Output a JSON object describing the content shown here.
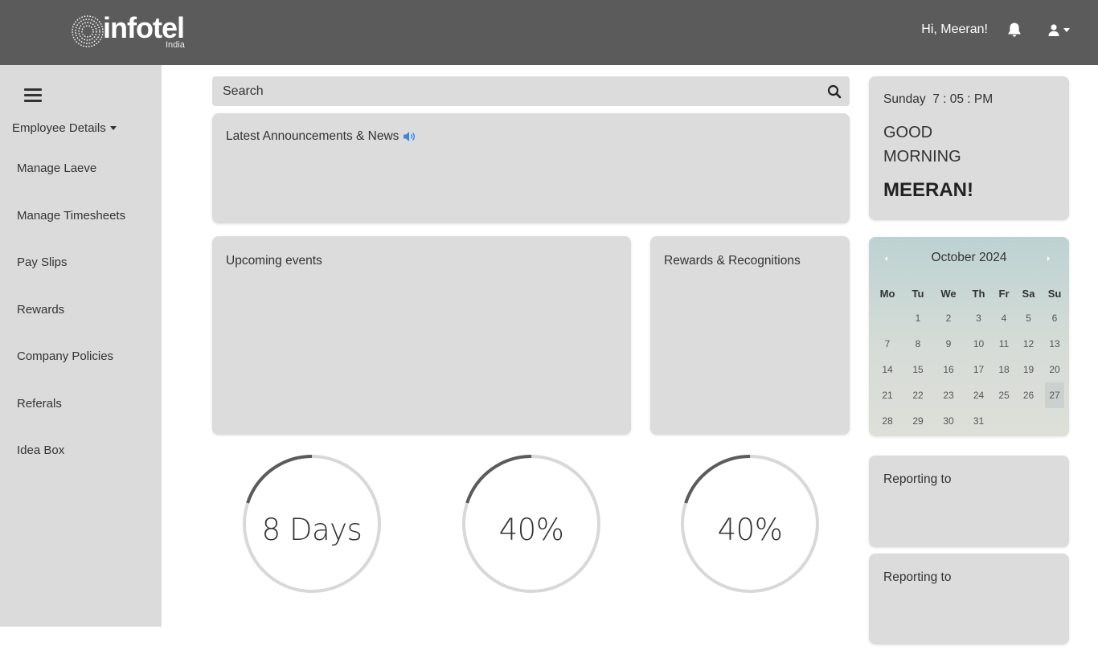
{
  "header": {
    "logo_text": "infotel",
    "logo_sub": "India",
    "greeting": "Hi, Meeran!",
    "colors": {
      "background": "#5b5b5b",
      "text": "#ffffff"
    },
    "icons": {
      "notifications": "bell-icon",
      "user": "user-icon",
      "dropdown": "caret-down-icon"
    }
  },
  "sidebar": {
    "section_label": "Employee Details",
    "items": [
      {
        "label": "Manage Laeve"
      },
      {
        "label": "Manage Timesheets"
      },
      {
        "label": "Pay Slips"
      },
      {
        "label": "Rewards"
      },
      {
        "label": "Company Policies"
      },
      {
        "label": "Referals"
      },
      {
        "label": "Idea Box"
      }
    ],
    "colors": {
      "background": "#dbdbdb"
    }
  },
  "search": {
    "placeholder": "Search",
    "icon": "search-icon"
  },
  "announcements": {
    "title": "Latest Announcements & News",
    "icon": "speaker-icon",
    "icon_color": "#3b86e0"
  },
  "events": {
    "title": "Upcoming events"
  },
  "rewards": {
    "title": "Rewards & Recognitions"
  },
  "welcome": {
    "day": "Sunday",
    "time": "7 : 05 : PM",
    "greeting": "GOOD MORNING",
    "name": "MEERAN!"
  },
  "calendar": {
    "title": "October 2024",
    "weekdays": [
      "Mo",
      "Tu",
      "We",
      "Th",
      "Fr",
      "Sa",
      "Su"
    ],
    "weeks": [
      [
        "",
        "1",
        "2",
        "3",
        "4",
        "5",
        "6"
      ],
      [
        "7",
        "8",
        "9",
        "10",
        "11",
        "12",
        "13"
      ],
      [
        "14",
        "15",
        "16",
        "17",
        "18",
        "19",
        "20"
      ],
      [
        "21",
        "22",
        "23",
        "24",
        "25",
        "26",
        "27"
      ],
      [
        "28",
        "29",
        "30",
        "31",
        "",
        "",
        ""
      ]
    ],
    "today": "27"
  },
  "stats": [
    {
      "label": "8 Days",
      "progress": 0.2
    },
    {
      "label": "40%",
      "progress": 0.2
    },
    {
      "label": "40%",
      "progress": 0.2
    }
  ],
  "reporting": [
    {
      "title": "Reporting to"
    },
    {
      "title": "Reporting to"
    }
  ],
  "colors": {
    "card": "#dcdcdc",
    "ring_track": "#d8d8d8",
    "ring_fill": "#5b5b5b"
  }
}
